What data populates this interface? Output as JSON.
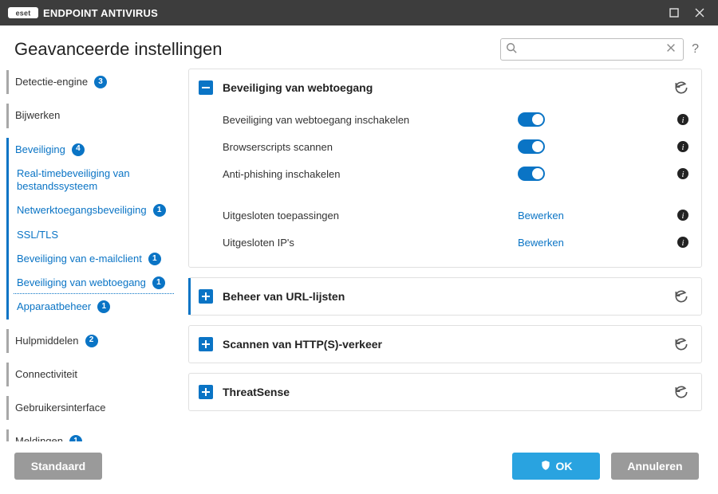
{
  "titlebar": {
    "product_prefix": "ENDPOINT ANTIVIRUS"
  },
  "header": {
    "title": "Geavanceerde instellingen",
    "search_placeholder": "",
    "help": "?"
  },
  "sidebar": [
    {
      "group": [
        {
          "label": "Detectie-engine",
          "badge": "3",
          "kind": "top"
        }
      ]
    },
    {
      "group": [
        {
          "label": "Bijwerken",
          "kind": "top"
        }
      ]
    },
    {
      "group": [
        {
          "label": "Beveiliging",
          "badge": "4",
          "kind": "top",
          "blue": true
        },
        {
          "label": "Real-timebeveiliging van bestandssysteem",
          "kind": "sub",
          "blue": true
        },
        {
          "label": "Netwerktoegangsbeveiliging",
          "badge": "1",
          "kind": "sub",
          "blue": true
        },
        {
          "label": "SSL/TLS",
          "kind": "sub",
          "blue": true
        },
        {
          "label": "Beveiliging van e-mailclient",
          "badge": "1",
          "kind": "sub",
          "blue": true
        },
        {
          "label": "Beveiliging van webtoegang",
          "badge": "1",
          "kind": "sub",
          "blue": true,
          "current": true
        },
        {
          "label": "Apparaatbeheer",
          "badge": "1",
          "kind": "sub",
          "blue": true
        }
      ]
    },
    {
      "group": [
        {
          "label": "Hulpmiddelen",
          "badge": "2",
          "kind": "top"
        }
      ]
    },
    {
      "group": [
        {
          "label": "Connectiviteit",
          "kind": "top"
        }
      ]
    },
    {
      "group": [
        {
          "label": "Gebruikersinterface",
          "kind": "top"
        }
      ]
    },
    {
      "group": [
        {
          "label": "Meldingen",
          "badge": "1",
          "kind": "top"
        }
      ]
    }
  ],
  "panels": {
    "web": {
      "title": "Beveiliging van webtoegang",
      "rows": [
        {
          "label": "Beveiliging van webtoegang inschakelen",
          "type": "toggle",
          "on": true
        },
        {
          "label": "Browserscripts scannen",
          "type": "toggle",
          "on": true
        },
        {
          "label": "Anti-phishing inschakelen",
          "type": "toggle",
          "on": true
        }
      ],
      "rows2": [
        {
          "label": "Uitgesloten toepassingen",
          "type": "link",
          "link": "Bewerken"
        },
        {
          "label": "Uitgesloten IP's",
          "type": "link",
          "link": "Bewerken"
        }
      ]
    },
    "url_lists": {
      "title": "Beheer van URL-lijsten"
    },
    "http_scan": {
      "title": "Scannen van HTTP(S)-verkeer"
    },
    "threatsense": {
      "title": "ThreatSense"
    }
  },
  "footer": {
    "default": "Standaard",
    "ok": "OK",
    "cancel": "Annuleren"
  }
}
